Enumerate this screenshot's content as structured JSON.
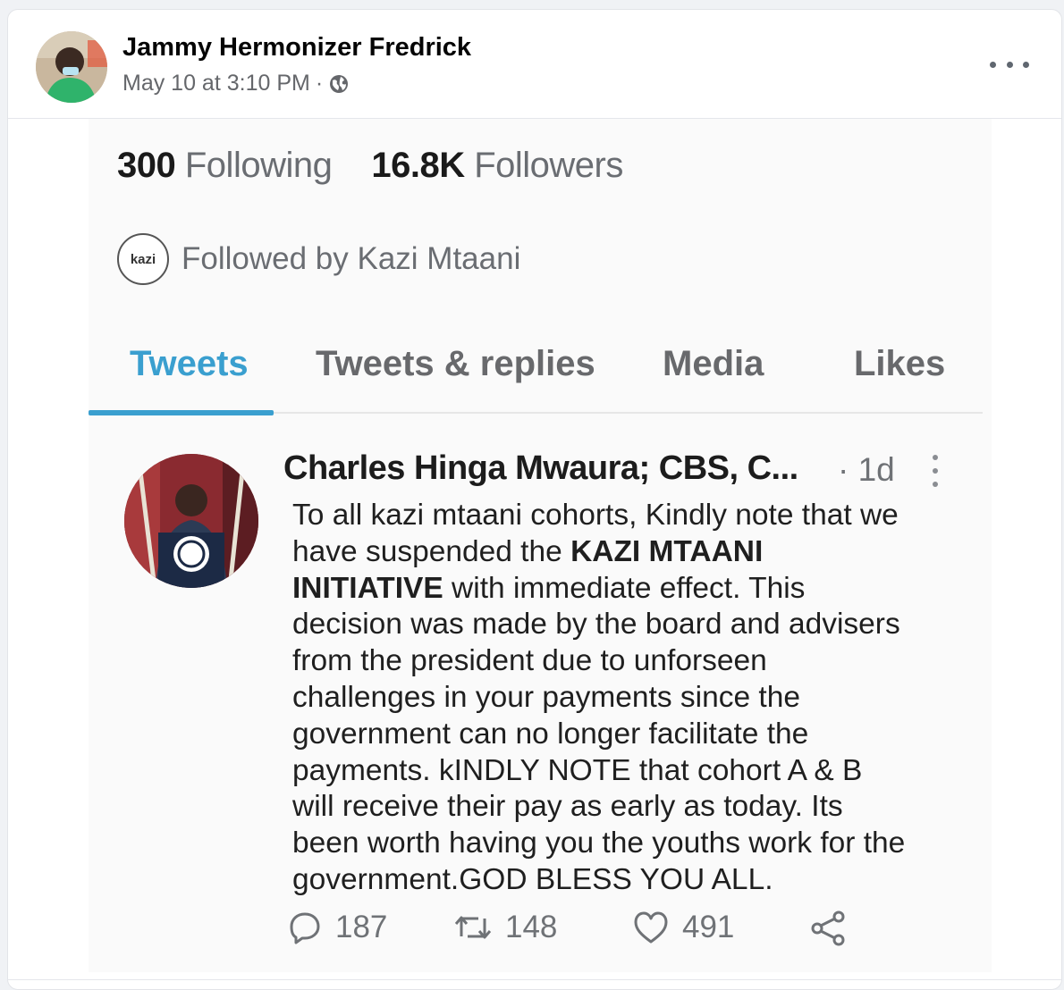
{
  "post": {
    "author": "Jammy Hermonizer Fredrick",
    "timestamp": "May 10 at 3:10 PM",
    "separator": "·",
    "privacy_icon": "globe-icon",
    "more_icon": "more-horizontal-icon"
  },
  "profile": {
    "following_count": "300",
    "following_label": "Following",
    "followers_count": "16.8K",
    "followers_label": "Followers",
    "followed_by": "Followed by Kazi Mtaani",
    "followed_by_logo_text": "kazi"
  },
  "tabs": [
    {
      "label": "Tweets",
      "active": true
    },
    {
      "label": "Tweets & replies",
      "active": false
    },
    {
      "label": "Media",
      "active": false
    },
    {
      "label": "Likes",
      "active": false
    }
  ],
  "tweet": {
    "author": "Charles Hinga Mwaura; CBS, C...",
    "time": "· 1d",
    "lines": [
      {
        "pre": "To all kazi mtaani cohorts, Kindly note that we",
        "bold": "",
        "post": ""
      },
      {
        "pre": "have suspended  the ",
        "bold": "KAZI MTAANI",
        "post": ""
      },
      {
        "pre": "",
        "bold": "INITIATIVE",
        "post": " with immediate effect. This"
      },
      {
        "pre": "decision was made by the board and advisers",
        "bold": "",
        "post": ""
      },
      {
        "pre": "from the president due to unforseen",
        "bold": "",
        "post": ""
      },
      {
        "pre": "challenges in your payments since the",
        "bold": "",
        "post": ""
      },
      {
        "pre": "government can no longer facilitate the",
        "bold": "",
        "post": ""
      },
      {
        "pre": "payments. kINDLY NOTE that  cohort A & B",
        "bold": "",
        "post": ""
      },
      {
        "pre": "will receive their pay as early as today. Its",
        "bold": "",
        "post": ""
      },
      {
        "pre": "been worth having you the youths work for the",
        "bold": "",
        "post": ""
      },
      {
        "pre": "government.GOD BLESS YOU ALL.",
        "bold": "",
        "post": ""
      }
    ],
    "replies": "187",
    "retweets": "148",
    "likes": "491"
  },
  "colors": {
    "accent": "#3a9fcf",
    "muted": "#6f7276",
    "facebook_gray": "#65676b"
  }
}
